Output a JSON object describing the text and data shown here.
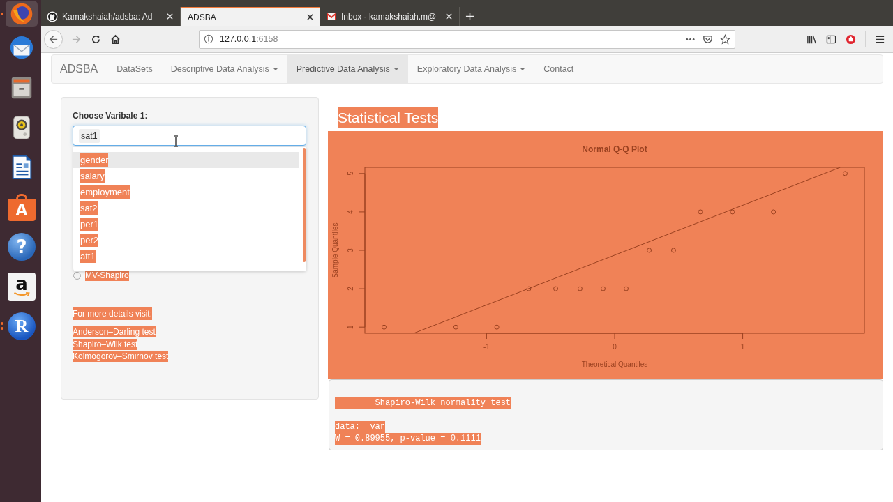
{
  "dock": {
    "items": [
      {
        "kind": "browser",
        "active": true,
        "running": true,
        "multiple_windows": false
      },
      {
        "kind": "mail",
        "active": false,
        "running": false,
        "multiple_windows": false
      },
      {
        "kind": "files",
        "active": false,
        "running": false,
        "multiple_windows": false
      },
      {
        "kind": "speaker",
        "active": false,
        "running": false,
        "multiple_windows": false
      },
      {
        "kind": "document",
        "active": false,
        "running": false,
        "multiple_windows": false
      },
      {
        "kind": "bag",
        "glyph": "A",
        "active": false,
        "running": false,
        "multiple_windows": false
      },
      {
        "kind": "help",
        "glyph": "?",
        "active": false,
        "running": false,
        "multiple_windows": false
      },
      {
        "kind": "store",
        "glyph": "a",
        "active": false,
        "running": false,
        "multiple_windows": false
      },
      {
        "kind": "r",
        "glyph": "R",
        "active": false,
        "running": true,
        "multiple_windows": true
      }
    ]
  },
  "browser": {
    "tabs": [
      {
        "title": "Kamakshaiah/adsba: Ad",
        "kind": "code",
        "selected": false
      },
      {
        "title": "ADSBA",
        "kind": "app",
        "selected": true
      },
      {
        "title": "Inbox - kamakshaiah.m@",
        "kind": "mail",
        "selected": false
      }
    ],
    "back": {
      "disabled": false
    },
    "forward": {
      "disabled": true
    },
    "address": {
      "host": "127.0.0.1",
      "port": ":6158"
    }
  },
  "app": {
    "brand": "ADSBA",
    "nav": [
      {
        "label": "DataSets",
        "dropdown": false,
        "selected": false
      },
      {
        "label": "Descriptive Data Analysis",
        "dropdown": true,
        "selected": false
      },
      {
        "label": "Predictive Data Analysis",
        "dropdown": true,
        "selected": true
      },
      {
        "label": "Exploratory Data Analysis",
        "dropdown": true,
        "selected": false
      },
      {
        "label": "Contact",
        "dropdown": false,
        "selected": false
      }
    ]
  },
  "sidebar": {
    "select": {
      "label": "Choose Varibale 1:",
      "value": "sat1",
      "options": [
        {
          "text": "gender",
          "active": true,
          "highlighted": true
        },
        {
          "text": "salary",
          "active": false,
          "highlighted": true
        },
        {
          "text": "employment",
          "active": false,
          "highlighted": true
        },
        {
          "text": "sat2",
          "active": false,
          "highlighted": true
        },
        {
          "text": "per1",
          "active": false,
          "highlighted": true
        },
        {
          "text": "per2",
          "active": false,
          "highlighted": true
        },
        {
          "text": "att1",
          "active": false,
          "highlighted": true
        }
      ]
    },
    "radios": [
      {
        "label": "MV-Shapiro",
        "selected": false,
        "highlighted": true
      }
    ],
    "details": {
      "intro": {
        "text": "For more details visit:",
        "highlighted": true
      },
      "links": [
        {
          "text": "Anderson–Darling test",
          "highlighted": true
        },
        {
          "text": "Shapiro–Wilk test",
          "highlighted": true
        },
        {
          "text": "Kolmogorov–Smirnov test",
          "highlighted": true
        }
      ]
    }
  },
  "main": {
    "heading": {
      "text": "Statistical Tests",
      "highlighted": true
    },
    "plot": {
      "highlighted": true,
      "chart_data": {
        "type": "scatter",
        "title": "Normal Q-Q Plot",
        "xlabel": "Theoretical Quantiles",
        "ylabel": "Sample Quantiles",
        "x": [
          -1.8,
          -1.24,
          -0.92,
          -0.67,
          -0.46,
          -0.27,
          -0.09,
          0.09,
          0.27,
          0.46,
          0.67,
          0.92,
          1.24,
          1.8
        ],
        "series": [
          {
            "values": [
              1,
              1,
              1,
              2,
              2,
              2,
              2,
              2,
              3,
              3,
              4,
              4,
              4,
              5
            ]
          }
        ],
        "xlim": [
          -1.95,
          1.95
        ],
        "ylim": [
          0.84,
          5.16
        ],
        "xticks": [
          -1,
          0,
          1
        ],
        "yticks": [
          1,
          2,
          3,
          4,
          5
        ]
      }
    },
    "output": {
      "paragraphs": [
        [
          {
            "text": "        Shapiro-Wilk normality test",
            "highlighted": true
          }
        ],
        [
          {
            "text": "data:  var",
            "highlighted": true
          },
          {
            "text": "W = 0.89955, p-value = 0.1111",
            "highlighted": true
          }
        ]
      ]
    }
  }
}
